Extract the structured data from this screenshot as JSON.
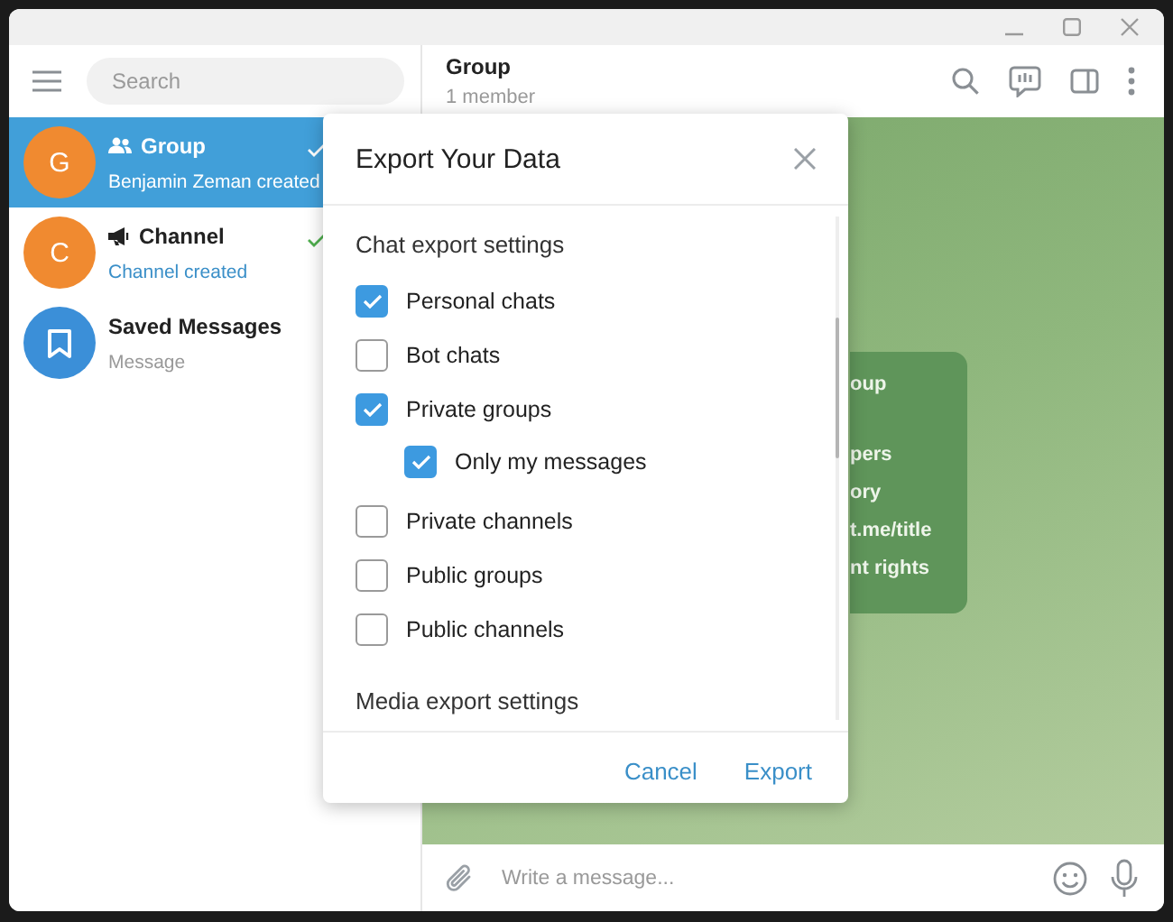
{
  "sidebar": {
    "search": {
      "placeholder": "Search"
    },
    "chats": [
      {
        "kind": "group",
        "name": "Group",
        "avatar": "G",
        "color": "#f08a30",
        "preview": "Benjamin Zeman created",
        "sent": true,
        "selected": true
      },
      {
        "kind": "channel",
        "name": "Channel",
        "avatar": "C",
        "color": "#f08a30",
        "preview": "Channel created",
        "sent": true,
        "selected": false
      },
      {
        "kind": "saved",
        "name": "Saved Messages",
        "color": "#3b8fd8",
        "preview": "Message",
        "sent": false,
        "selected": false
      }
    ]
  },
  "chat": {
    "title": "Group",
    "subtitle": "1 member",
    "card": {
      "title": "oup",
      "lines": [
        "pers",
        "ory",
        "t.me/title",
        "nt rights"
      ]
    },
    "composer": {
      "placeholder": "Write a message..."
    }
  },
  "dialog": {
    "title": "Export Your Data",
    "sections": [
      {
        "heading": "Chat export settings",
        "options": [
          {
            "label": "Personal chats",
            "checked": true
          },
          {
            "label": "Bot chats",
            "checked": false
          },
          {
            "label": "Private groups",
            "checked": true,
            "children": [
              {
                "label": "Only my messages",
                "checked": true
              }
            ]
          },
          {
            "label": "Private channels",
            "checked": false
          },
          {
            "label": "Public groups",
            "checked": false
          },
          {
            "label": "Public channels",
            "checked": false
          }
        ]
      },
      {
        "heading": "Media export settings"
      }
    ],
    "buttons": [
      "Cancel",
      "Export"
    ]
  }
}
